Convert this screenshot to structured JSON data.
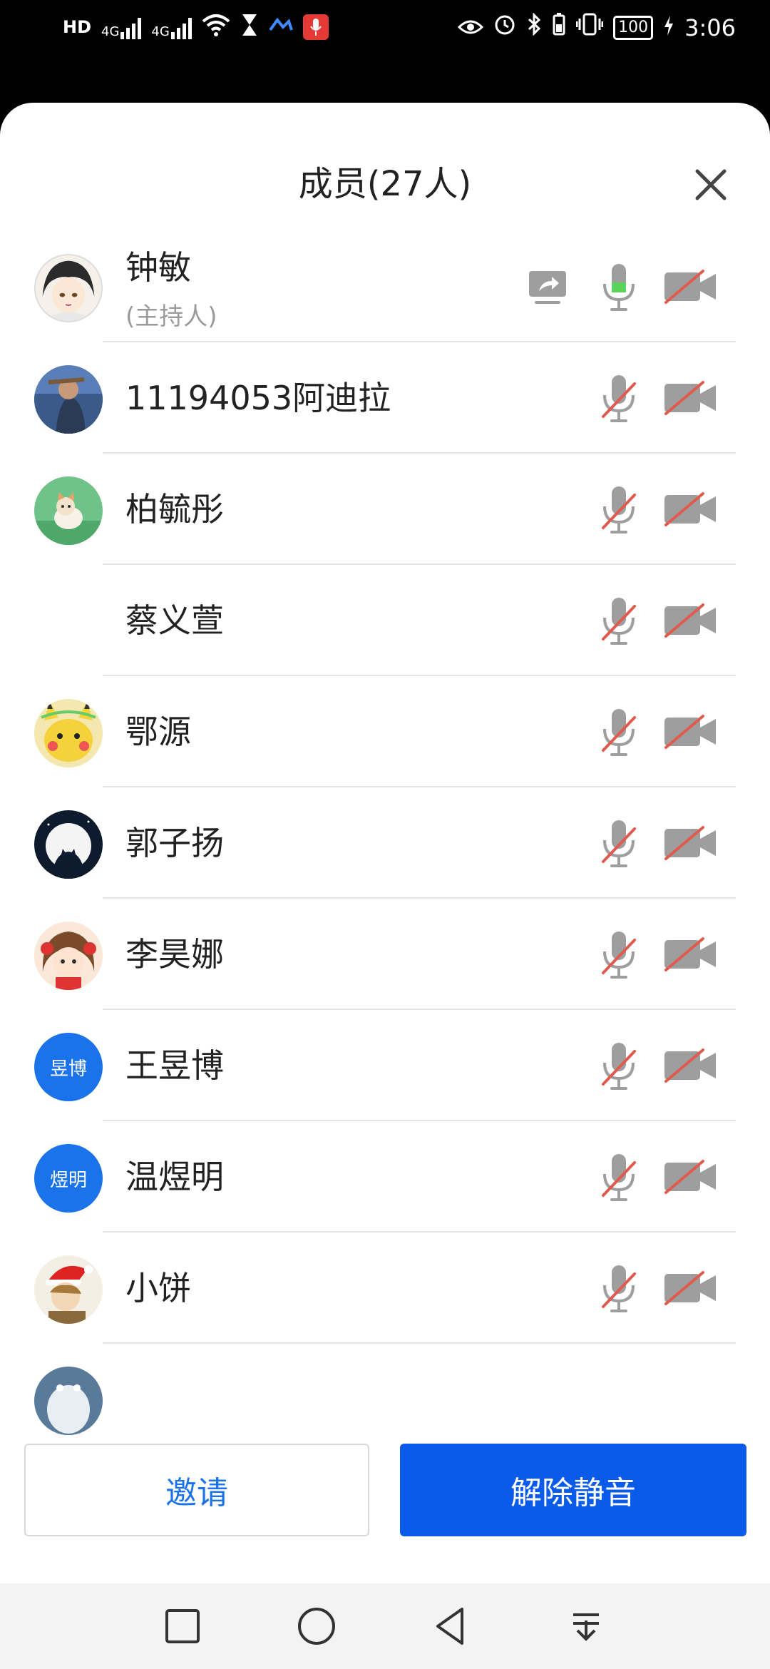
{
  "status_bar": {
    "left_indicators": [
      "HD",
      "4G",
      "4G",
      "wifi-icon",
      "hourglass-icon",
      "cast-icon",
      "mic-recording-icon"
    ],
    "battery": "100",
    "time": "3:06"
  },
  "panel": {
    "title": "成员(27人)",
    "close_icon": "close-icon"
  },
  "members": [
    {
      "name": "钟敏",
      "role": "(主持人)",
      "avatar": "anime-avatar",
      "mic": "active",
      "camera": "off",
      "sharing": true
    },
    {
      "name": "11194053阿迪拉",
      "avatar": "photo-avatar",
      "mic": "muted",
      "camera": "off"
    },
    {
      "name": "柏毓彤",
      "avatar": "kitten-avatar",
      "mic": "muted",
      "camera": "off"
    },
    {
      "name": "蔡义萱",
      "avatar": "",
      "mic": "muted",
      "camera": "off"
    },
    {
      "name": "鄂源",
      "avatar": "pikachu-avatar",
      "mic": "muted",
      "camera": "off"
    },
    {
      "name": "郭子扬",
      "avatar": "moon-avatar",
      "mic": "muted",
      "camera": "off"
    },
    {
      "name": "李昊娜",
      "avatar": "girl-avatar",
      "mic": "muted",
      "camera": "off"
    },
    {
      "name": "王昱博",
      "avatar_text": "昱博",
      "mic": "muted",
      "camera": "off"
    },
    {
      "name": "温煜明",
      "avatar_text": "煜明",
      "mic": "muted",
      "camera": "off"
    },
    {
      "name": "小饼",
      "avatar": "christmas-avatar",
      "mic": "muted",
      "camera": "off"
    }
  ],
  "buttons": {
    "invite": "邀请",
    "unmute": "解除静音"
  },
  "colors": {
    "accent": "#0a5bea",
    "link": "#1a73e8",
    "muted_slash": "#e05a4e",
    "icon_gray": "#9e9e9e",
    "mic_active": "#5bd35b"
  }
}
